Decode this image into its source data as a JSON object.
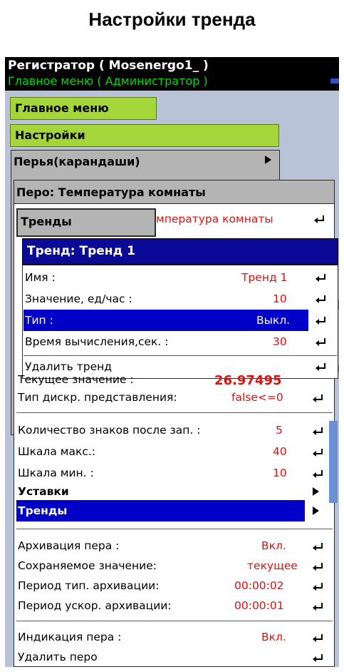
{
  "page_title": "Настройки тренда",
  "topbar": {
    "line1": "Регистратор ( Mosenergo1_ )",
    "line2": "Главное меню ( Администратор )"
  },
  "tabs": {
    "main_menu": "Главное меню",
    "settings": "Настройки",
    "pens": "Перья(карандаши)",
    "pen": "Перо: Температура комнаты",
    "trends": "Тренды",
    "pen_name_value": "мпература комнаты"
  },
  "trend_dialog": {
    "title": "Тренд: Тренд 1",
    "rows": [
      {
        "label": "Имя :",
        "value": "Тренд 1"
      },
      {
        "label": "Значение, ед/час :",
        "value": "10"
      },
      {
        "label": "Тип :",
        "value": "Выкл."
      },
      {
        "label": "Время вычисления,сек. :",
        "value": "30"
      }
    ],
    "delete": "Удалить тренд"
  },
  "pen_menu": {
    "current_value_label": "Текущее значение :",
    "current_value": "26.97495",
    "discrete_type_label": "Тип дискр. представления:",
    "discrete_type_value": "false<=0",
    "decimals_label": "Количество знаков после зап. :",
    "decimals_value": "5",
    "scale_max_label": "Шкала макс.:",
    "scale_max_value": "40",
    "scale_min_label": "Шкала мин. :",
    "scale_min_value": "10",
    "setpoints": "Уставки",
    "trends": "Тренды",
    "archive_label": "Архивация пера :",
    "archive_value": "Вкл.",
    "saved_value_label": "Сохраняемое значение:",
    "saved_value": "текущее",
    "period_typ_label": "Период тип. архивации:",
    "period_typ_value": "00:00:02",
    "period_fast_label": "Период ускор. архивации:",
    "period_fast_value": "00:00:01",
    "indication_label": "Индикация пера :",
    "indication_value": "Вкл.",
    "delete_pen": "Удалить перо"
  },
  "colors": {
    "selection": "#0000c8",
    "value_red": "#e01010",
    "tab_green": "#a4d63a",
    "header_blue": "#0a0a96"
  }
}
